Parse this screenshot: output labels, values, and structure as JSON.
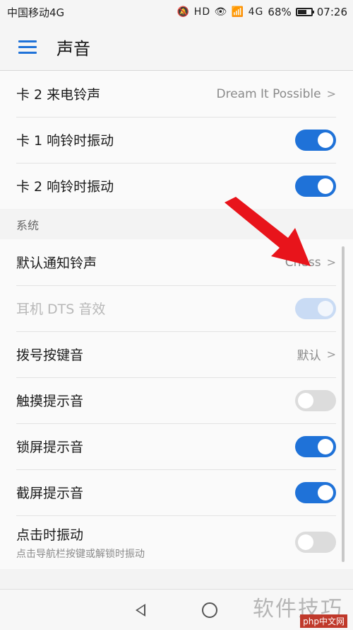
{
  "status_bar": {
    "carrier": "中国移动4G",
    "icons": "🔕 HD 👁 📶 4G",
    "battery_percent": "68%",
    "battery_level": 0.68,
    "time": "07:26"
  },
  "header": {
    "title": "声音"
  },
  "rows_top": [
    {
      "label": "卡 2 来电铃声",
      "value": "Dream It Possible"
    },
    {
      "label": "卡 1 响铃时振动",
      "toggle": "on"
    },
    {
      "label": "卡 2 响铃时振动",
      "toggle": "on"
    }
  ],
  "section": {
    "label": "系统"
  },
  "rows_system": [
    {
      "label": "默认通知铃声",
      "value": "Chess"
    },
    {
      "label": "耳机 DTS 音效",
      "toggle": "disabled-on"
    },
    {
      "label": "拨号按键音",
      "value": "默认"
    },
    {
      "label": "触摸提示音",
      "toggle": "off"
    },
    {
      "label": "锁屏提示音",
      "toggle": "on"
    },
    {
      "label": "截屏提示音",
      "toggle": "on"
    },
    {
      "label": "点击时振动",
      "sub": "点击导航栏按键或解锁时振动",
      "toggle": "off"
    }
  ],
  "chevron": ">",
  "colors": {
    "accent": "#1f72d8",
    "arrow": "#e8141b"
  },
  "watermark": {
    "text": "软件技巧",
    "badge": "php中文网"
  }
}
